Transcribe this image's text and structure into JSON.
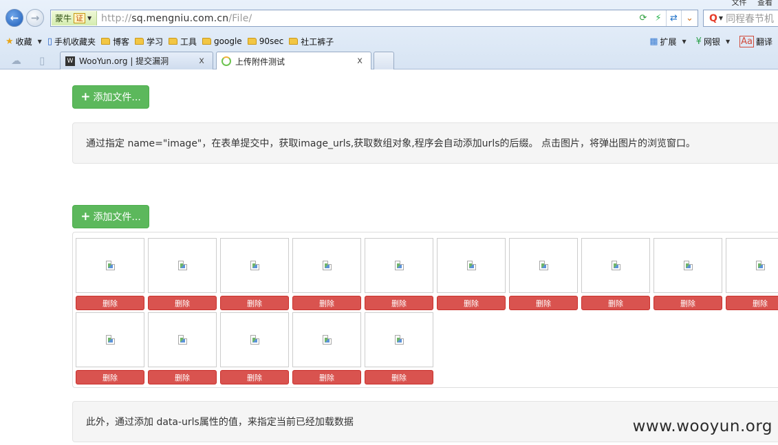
{
  "browser": {
    "title_menu": [
      "文件",
      "查看"
    ],
    "address": {
      "cert_label": "蒙牛",
      "cert_mark": "证",
      "url_prefix": "http://",
      "url_host": "sq.mengniu.com.cn",
      "url_path": "/File/"
    },
    "search_placeholder": "同程春节机",
    "favorites": {
      "collect_label": "收藏",
      "items": [
        {
          "label": "手机收藏夹",
          "icon": "phone-icon"
        },
        {
          "label": "博客",
          "icon": "folder-icon"
        },
        {
          "label": "学习",
          "icon": "folder-icon"
        },
        {
          "label": "工具",
          "icon": "folder-icon"
        },
        {
          "label": "google",
          "icon": "folder-icon"
        },
        {
          "label": "90sec",
          "icon": "folder-icon"
        },
        {
          "label": "社工裤子",
          "icon": "folder-icon"
        }
      ],
      "right": [
        {
          "label": "扩展",
          "icon": "extension-icon"
        },
        {
          "label": "网银",
          "icon": "bank-icon"
        },
        {
          "label": "翻译",
          "icon": "translate-icon"
        }
      ]
    },
    "tabs": [
      {
        "label": "WooYun.org | 提交漏洞",
        "close": "x"
      },
      {
        "label": "上传附件测试",
        "close": "x"
      }
    ]
  },
  "page": {
    "add_button_label": "添加文件...",
    "notes": {
      "first": "通过指定 name=\"image\"，在表单提交中，获取image_urls,获取数组对象,程序会自动添加urls的后缀。 点击图片，将弹出图片的浏览窗口。",
      "second": "此外，通过添加 data-urls属性的值，来指定当前已经加载数据"
    },
    "delete_label": "删除",
    "thumbnail_count": 15,
    "watermark": "www.wooyun.org"
  },
  "colors": {
    "add_button": "#5cb85c",
    "delete_button": "#d9534f",
    "well_background": "#f5f5f5"
  }
}
